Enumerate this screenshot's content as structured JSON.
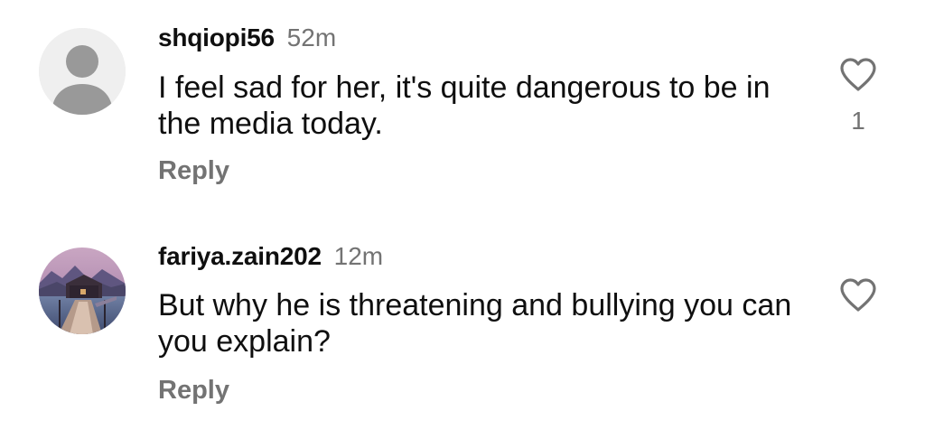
{
  "comments": [
    {
      "username": "shqiopi56",
      "timestamp": "52m",
      "text": "I feel sad for her, it's quite dangerous to be in the media today.",
      "reply_label": "Reply",
      "like_count": "1",
      "avatar": "default-profile-avatar",
      "like_icon": "heart-outline-icon"
    },
    {
      "username": "fariya.zain202",
      "timestamp": "12m",
      "text": "But why he is threatening and bullying you can you explain?",
      "reply_label": "Reply",
      "avatar": "profile-photo-avatar",
      "like_icon": "heart-outline-icon"
    }
  ],
  "colors": {
    "primary_text": "#0f0f0f",
    "secondary_text": "#737373",
    "default_avatar_bg": "#efefef",
    "default_avatar_fg": "#999999"
  }
}
